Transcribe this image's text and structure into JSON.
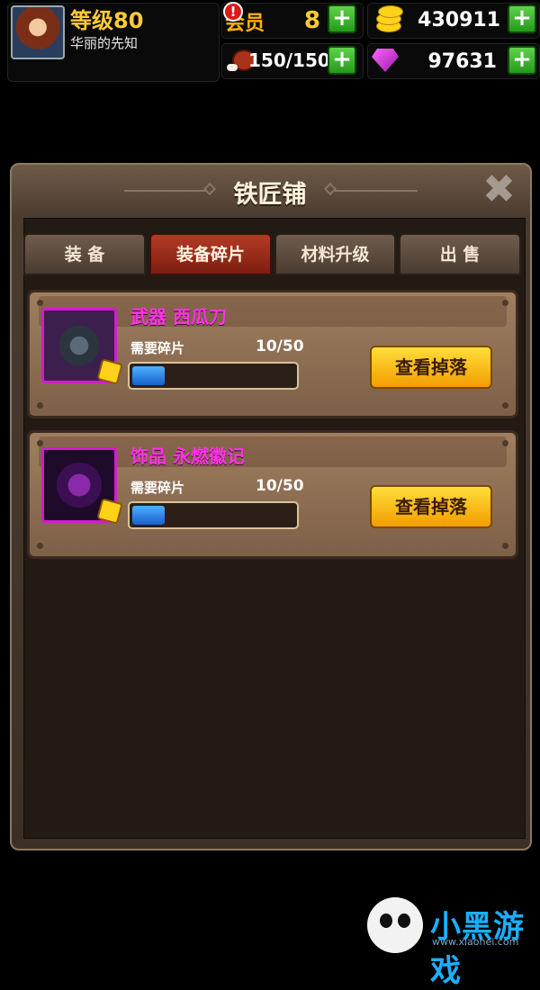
{
  "hud": {
    "level": "等级80",
    "player_title": "华丽的先知",
    "vip_label": "会员",
    "vip_level": "8",
    "alert_mark": "!",
    "coins": "430911",
    "stamina": "150/150",
    "gems": "97631",
    "plus": "+"
  },
  "panel": {
    "title": "铁匠铺",
    "close": "✖",
    "tabs": [
      {
        "label": "装 备",
        "active": false
      },
      {
        "label": "装备碎片",
        "active": true
      },
      {
        "label": "材料升级",
        "active": false
      },
      {
        "label": "出 售",
        "active": false
      }
    ]
  },
  "items": [
    {
      "name": "武器  西瓜刀",
      "need_label": "需要碎片",
      "count": "10/50",
      "progress": 0.2,
      "button": "查看掉落",
      "icon": "dark-sword-icon"
    },
    {
      "name": "饰品  永燃徽记",
      "need_label": "需要碎片",
      "count": "10/50",
      "progress": 0.2,
      "button": "查看掉落",
      "icon": "purple-emblem-icon"
    }
  ],
  "watermark": {
    "brand": "小黑游戏",
    "url": "www.xiaohei.com"
  },
  "colors": {
    "accent_pink": "#ff33e6",
    "gold": "#ffcc33",
    "button_yellow": "#ffc21a",
    "tab_active": "#9c2a18"
  }
}
